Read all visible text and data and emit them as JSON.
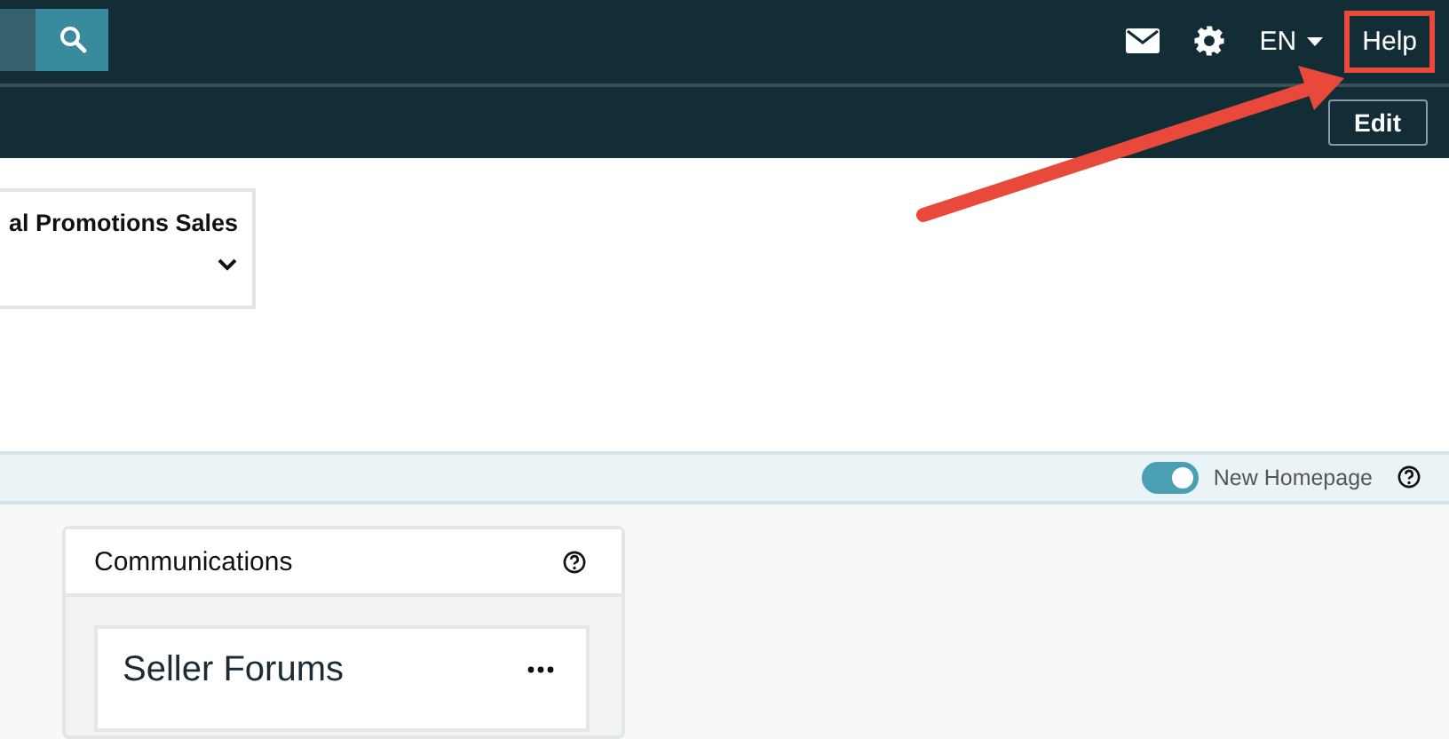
{
  "header": {
    "language": "EN",
    "help": {
      "label": "Help",
      "highlighted": true
    }
  },
  "subbar": {
    "edit_button": "Edit"
  },
  "widget": {
    "title": "al Promotions Sales",
    "expanded": false
  },
  "toggle_bar": {
    "label": "New Homepage",
    "on": true
  },
  "communications": {
    "title": "Communications",
    "tile": {
      "title": "Seller Forums"
    }
  }
}
